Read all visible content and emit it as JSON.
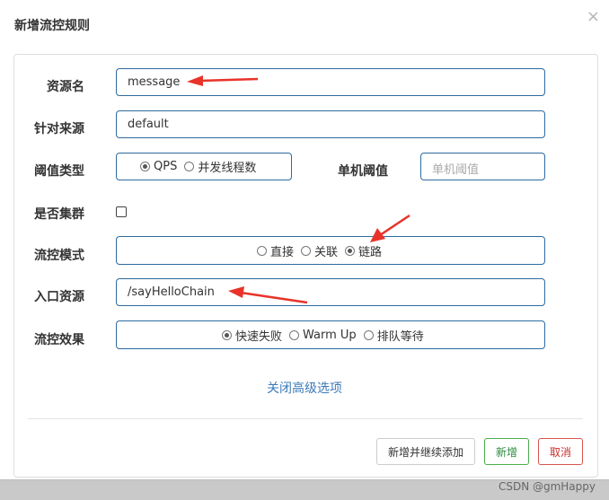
{
  "dialog": {
    "title": "新增流控规则",
    "close_glyph": "×"
  },
  "form": {
    "resource_label": "资源名",
    "resource_value": "message",
    "origin_label": "针对来源",
    "origin_value": "default",
    "threshold_type_label": "阈值类型",
    "threshold_type_options": [
      "QPS",
      "并发线程数"
    ],
    "threshold_type_selected": "QPS",
    "single_threshold_label": "单机阈值",
    "single_threshold_placeholder": "单机阈值",
    "cluster_label": "是否集群",
    "cluster_checked": false,
    "flow_mode_label": "流控模式",
    "flow_mode_options": [
      "直接",
      "关联",
      "链路"
    ],
    "flow_mode_selected": "链路",
    "entry_resource_label": "入口资源",
    "entry_resource_value": "/sayHelloChain",
    "flow_effect_label": "流控效果",
    "flow_effect_options": [
      "快速失败",
      "Warm Up",
      "排队等待"
    ],
    "flow_effect_selected": "快速失败"
  },
  "advanced_link": "关闭高级选项",
  "buttons": {
    "add_continue": "新增并继续添加",
    "add": "新增",
    "cancel": "取消"
  },
  "watermark": "CSDN @gmHappy",
  "colors": {
    "input_border": "#2d6a9f",
    "link": "#3c7ab7",
    "add_button": "#2b8a3e",
    "cancel_button": "#c9302c",
    "annotation_arrow": "#e8332a"
  }
}
